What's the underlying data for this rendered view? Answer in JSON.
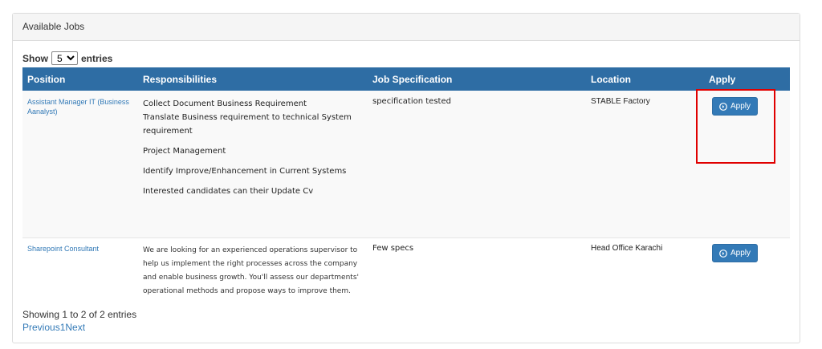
{
  "panel": {
    "title": "Available Jobs"
  },
  "length_control": {
    "show_label": "Show",
    "selected": "5",
    "entries_label": "entries"
  },
  "table": {
    "headers": [
      "Position",
      "Responsibilities",
      "Job Specification",
      "Location",
      "Apply"
    ],
    "rows": [
      {
        "position": "Assistant Manager IT (Business Aanalyst)",
        "responsibilities": [
          "Collect Document Business Requirement",
          "Translate Business requirement to technical System requirement",
          "Project Management",
          "Identify Improve/Enhancement in Current Systems",
          "Interested candidates can their Update Cv"
        ],
        "specification": "specification tested",
        "location": "STABLE Factory",
        "apply_label": "Apply"
      },
      {
        "position": "Sharepoint Consultant",
        "responsibilities_text": "We are looking for an experienced operations supervisor to help us implement the right processes across the company and enable business growth. You'll assess our departments' operational methods and propose ways to improve them.",
        "specification": "Few specs",
        "location": "Head Office Karachi",
        "apply_label": "Apply"
      }
    ]
  },
  "info": "Showing 1 to 2 of 2 entries",
  "pagination": {
    "previous": "Previous",
    "page": "1",
    "next": "Next"
  },
  "colors": {
    "header_bg": "#2e6da4",
    "button_bg": "#337ab7",
    "link": "#337ab7",
    "highlight": "#e00000"
  },
  "icons": {
    "apply": "arrow-circle-right-icon",
    "select": "chevron-down-icon"
  }
}
